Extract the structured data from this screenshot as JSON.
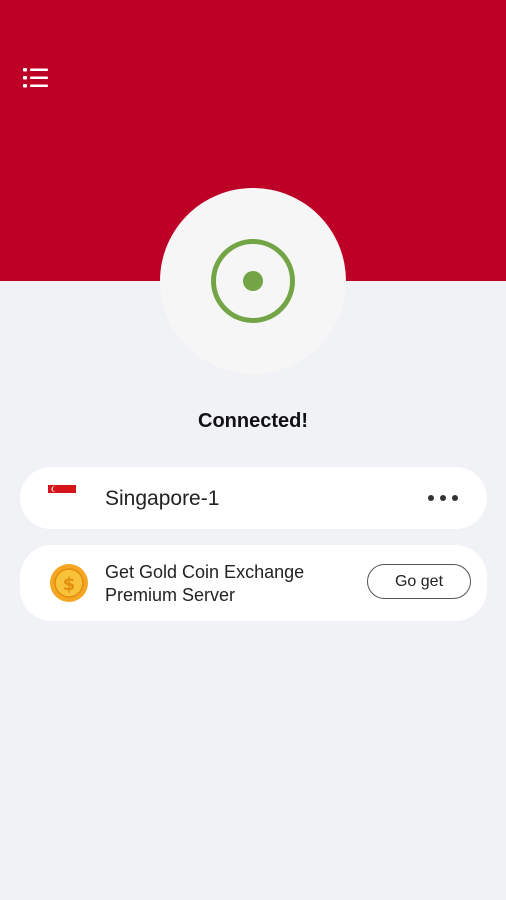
{
  "header": {
    "background_color": "#bd0026",
    "menu_icon": "list-menu-icon"
  },
  "connection": {
    "status_text": "Connected!",
    "status_color": "#73a546",
    "icon": "connected-power-icon"
  },
  "server": {
    "name": "Singapore-1",
    "flag_icon": "singapore-flag-icon",
    "more_icon": "more-horizontal-icon"
  },
  "promo": {
    "line1": "Get Gold Coin Exchange",
    "line2": "Premium Server",
    "coin_icon": "gold-coin-icon",
    "button_label": "Go get"
  }
}
